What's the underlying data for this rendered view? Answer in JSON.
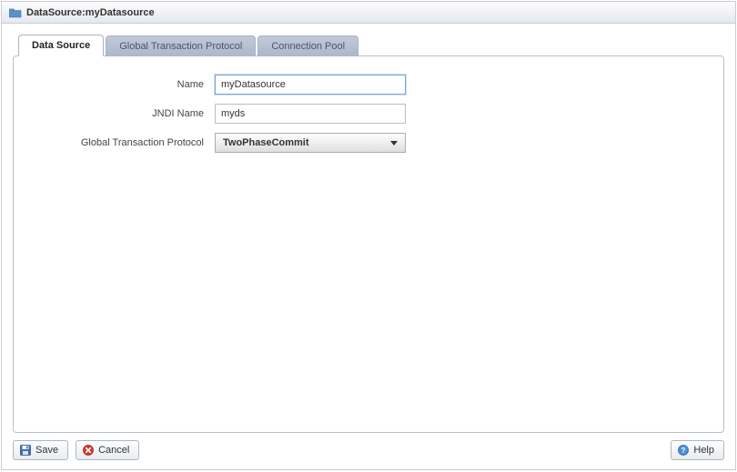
{
  "title": "DataSource:myDatasource",
  "tabs": [
    {
      "label": "Data Source",
      "active": true
    },
    {
      "label": "Global Transaction Protocol",
      "active": false
    },
    {
      "label": "Connection Pool",
      "active": false
    }
  ],
  "form": {
    "name_label": "Name",
    "name_value": "myDatasource",
    "jndi_label": "JNDI Name",
    "jndi_value": "myds",
    "protocol_label": "Global Transaction Protocol",
    "protocol_value": "TwoPhaseCommit"
  },
  "buttons": {
    "save": "Save",
    "cancel": "Cancel",
    "help": "Help"
  }
}
